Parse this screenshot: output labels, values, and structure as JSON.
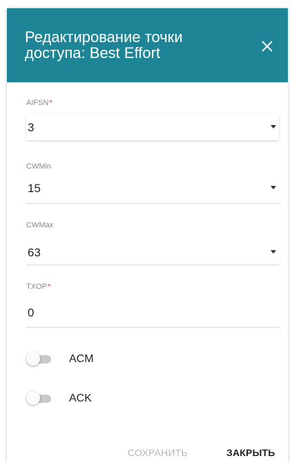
{
  "dialog": {
    "title": "Редактирование точки доступа: Best Effort",
    "close_icon": "close-icon",
    "header_color": "#1d8596"
  },
  "fields": {
    "aifsn": {
      "label": "AIFSN",
      "required": "*",
      "value": "3"
    },
    "cwmin": {
      "label": "CWMin",
      "value": "15"
    },
    "cwmax": {
      "label": "CWMax",
      "value": "63"
    },
    "txop": {
      "label": "TXOP",
      "required": "*",
      "value": "0"
    }
  },
  "toggles": {
    "acm": {
      "label": "ACM",
      "state": "off"
    },
    "ack": {
      "label": "ACK",
      "state": "off"
    }
  },
  "footer": {
    "save_label": "СОХРАНИТЬ",
    "close_label": "ЗАКРЫТЬ"
  }
}
